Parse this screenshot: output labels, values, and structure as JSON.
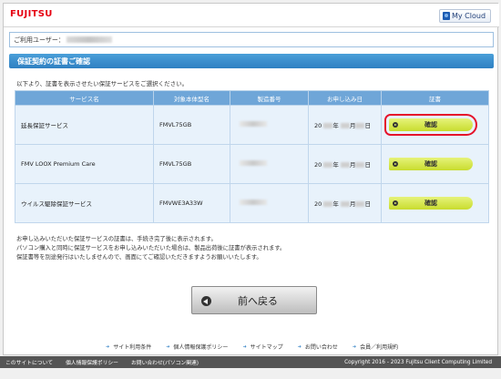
{
  "header": {
    "brand": "FUJITSU",
    "service_logo": "My Cloud"
  },
  "user": {
    "label": "ご利用ユーザー："
  },
  "section": {
    "title": "保証契約の証書ご確認",
    "instruction": "以下より、証書を表示させたい保証サービスをご選択ください。"
  },
  "table": {
    "headers": [
      "サービス名",
      "対象本体型名",
      "製造番号",
      "お申し込み日",
      "証書"
    ],
    "rows": [
      {
        "service": "延長保証サービス",
        "model": "FMVL75GB",
        "date_prefix": "20",
        "date_year": "年",
        "date_month": "月",
        "date_day": "日",
        "button": "確認"
      },
      {
        "service": "FMV LOOX Premium Care",
        "model": "FMVL75GB",
        "date_prefix": "20",
        "date_year": "年",
        "date_month": "月",
        "date_day": "日",
        "button": "確認"
      },
      {
        "service": "ウイルス駆除保証サービス",
        "model": "FMVWE3A33W",
        "date_prefix": "20",
        "date_year": "年",
        "date_month": "月",
        "date_day": "日",
        "button": "確認"
      }
    ]
  },
  "notes": [
    "お申し込みいただいた保証サービスの証書は、手続き完了後に表示されます。",
    "パソコン購入と同時に保証サービスをお申し込みいただいた場合は、製品出荷後に証書が表示されます。",
    "保証書等を別途発行はいたしませんので、画面にてご確認いただきますようお願いいたします。"
  ],
  "back_button": "前へ戻る",
  "footer_links": [
    "サイト利用条件",
    "個人情報保護ポリシー",
    "サイトマップ",
    "お問い合わせ",
    "会員／利用規約"
  ],
  "bottom_bar": {
    "links": [
      "このサイトについて",
      "個人情報保護ポリシー",
      "お問い合わせ(パソコン関連)"
    ],
    "copyright": "Copyright 2016 - 2023 Fujitsu Client Computing Limited"
  },
  "colors": {
    "brand_red": "#e60012",
    "title_blue": "#3a8fd0",
    "confirm_yellow": "#d4e43a",
    "highlight_red": "#e5122a"
  }
}
